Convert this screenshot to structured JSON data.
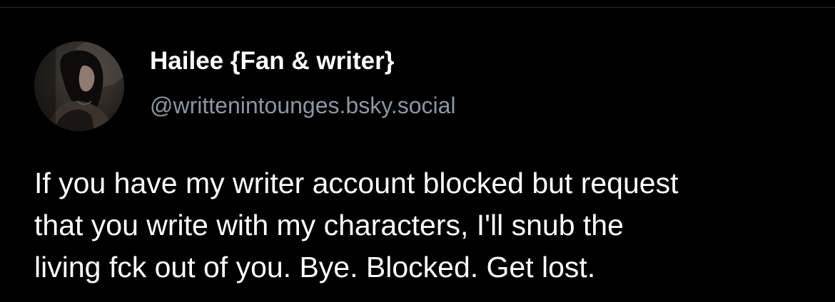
{
  "post": {
    "author": {
      "display_name": "Hailee {Fan & writer}",
      "handle": "@writtenintounges.bsky.social",
      "avatar_icon": "profile-photo"
    },
    "text_lines": [
      "If you have my writer account blocked but request",
      "that you write with my characters, I'll snub the",
      "living fck out of you. Bye. Blocked. Get lost."
    ]
  },
  "colors": {
    "background": "#000000",
    "text": "#ffffff",
    "handle": "#8b96a6",
    "divider": "#262a30"
  }
}
